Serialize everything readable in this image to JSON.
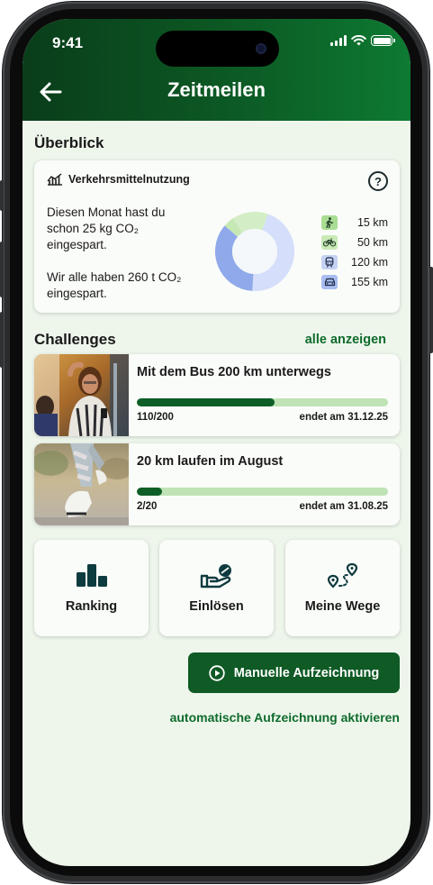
{
  "status_bar": {
    "time": "9:41"
  },
  "header": {
    "title": "Zeitmeilen"
  },
  "overview": {
    "section_title": "Überblick",
    "card_title": "Verkehrsmittelnutzung",
    "help_symbol": "?",
    "personal_savings": "Diesen Monat hast du schon 25 kg CO₂ eingespart.",
    "community_savings": "Wir alle haben 260 t CO₂ eingespart.",
    "modes": [
      {
        "icon": "walk-icon",
        "value": "15 km",
        "km": 15,
        "color": "#c6e8b4",
        "icon_bg": "#a9dd93"
      },
      {
        "icon": "bike-icon",
        "value": "50 km",
        "km": 50,
        "color": "#d3edc6",
        "icon_bg": "#c9e9b6"
      },
      {
        "icon": "train-icon",
        "value": "120 km",
        "km": 120,
        "color": "#8fa9ea",
        "icon_bg": "#c5d3f4"
      },
      {
        "icon": "car-icon",
        "value": "155 km",
        "km": 155,
        "color": "#d5defa",
        "icon_bg": "#a9bdf0"
      }
    ]
  },
  "challenges": {
    "section_title": "Challenges",
    "see_all": "alle anzeigen",
    "items": [
      {
        "name": "Mit dem Bus 200 km unterwegs",
        "progress_label": "110/200",
        "progress": 0.55,
        "deadline": "endet am 31.12.25",
        "image": "bus-passengers-photo"
      },
      {
        "name": "20 km laufen im August",
        "progress_label": "2/20",
        "progress": 0.1,
        "deadline": "endet am 31.08.25",
        "image": "running-shoes-photo"
      }
    ]
  },
  "tiles": [
    {
      "label": "Ranking",
      "icon": "podium-icon"
    },
    {
      "label": "Einlösen",
      "icon": "redeem-hand-icon"
    },
    {
      "label": "Meine Wege",
      "icon": "route-icon"
    }
  ],
  "actions": {
    "manual_record": "Manuelle Aufzeichnung",
    "auto_record": "automatische Aufzeichnung aktivieren"
  },
  "colors": {
    "brand_dark": "#0a3d1a",
    "brand": "#0f5a25",
    "link": "#0f6b2c",
    "background": "#eef6ec",
    "progress_track": "#bfe3b5"
  }
}
